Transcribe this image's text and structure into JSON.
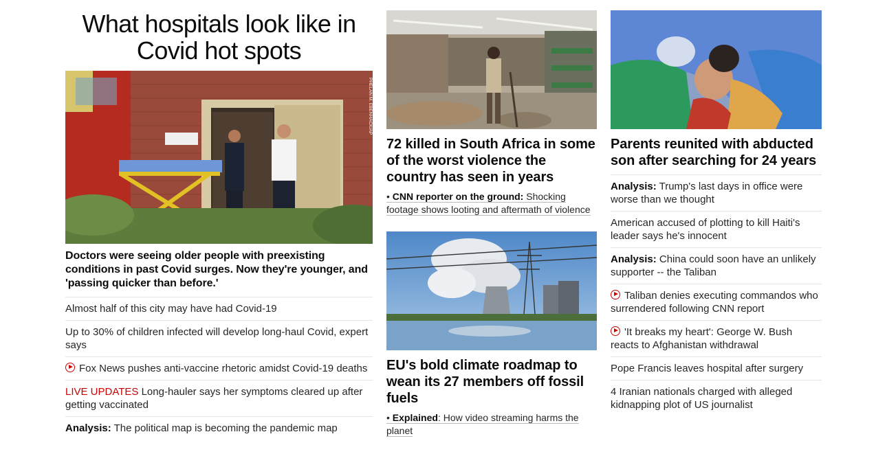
{
  "left": {
    "title": "What hospitals look like in Covid hot spots",
    "lead_caption": "Doctors were seeing older people with preexisting conditions in past Covid surges. Now they're younger, and 'passing quicker than before.'",
    "image_credit": "PHELAN M. EBENHACK/AP",
    "list": [
      {
        "text": "Almost half of this city may have had Covid-19"
      },
      {
        "text": "Up to 30% of children infected will develop long-haul Covid, expert says"
      },
      {
        "video": true,
        "text": "Fox News pushes anti-vaccine rhetoric amidst Covid-19 deaths"
      },
      {
        "live": "LIVE UPDATES",
        "text": " Long-hauler says her symptoms cleared up after getting vaccinated"
      },
      {
        "kicker": "Analysis:",
        "text": " The political map is becoming the pandemic map"
      }
    ]
  },
  "middle": {
    "card1": {
      "title": "72 killed in South Africa in some of the worst violence the country has seen in years",
      "sub_bullet": "• ",
      "sub_kicker": "CNN reporter on the ground:",
      "sub_text": " Shocking footage shows looting and aftermath of violence"
    },
    "card2": {
      "title": "EU's bold climate roadmap to wean its 27 members off fossil fuels",
      "sub_bullet": "• ",
      "sub_kicker": "Explained",
      "sub_text": ": How video streaming harms the planet"
    }
  },
  "right": {
    "title": "Parents reunited with abducted son after searching for 24 years",
    "list": [
      {
        "kicker": "Analysis:",
        "text": " Trump's last days in office were worse than we thought"
      },
      {
        "text": "American accused of plotting to kill Haiti's leader says he's innocent"
      },
      {
        "kicker": "Analysis:",
        "text": " China could soon have an unlikely supporter -- the Taliban"
      },
      {
        "video": true,
        "text": "Taliban denies executing commandos who surrendered following CNN report"
      },
      {
        "video": true,
        "text": "'It breaks my heart': George W. Bush reacts to Afghanistan withdrawal"
      },
      {
        "text": "Pope Francis leaves hospital after surgery"
      },
      {
        "text": "4 Iranian nationals charged with alleged kidnapping plot of US journalist"
      }
    ]
  },
  "colors": {
    "accent_red": "#cc0000",
    "text": "#262626",
    "divider": "#e6e6e6"
  }
}
